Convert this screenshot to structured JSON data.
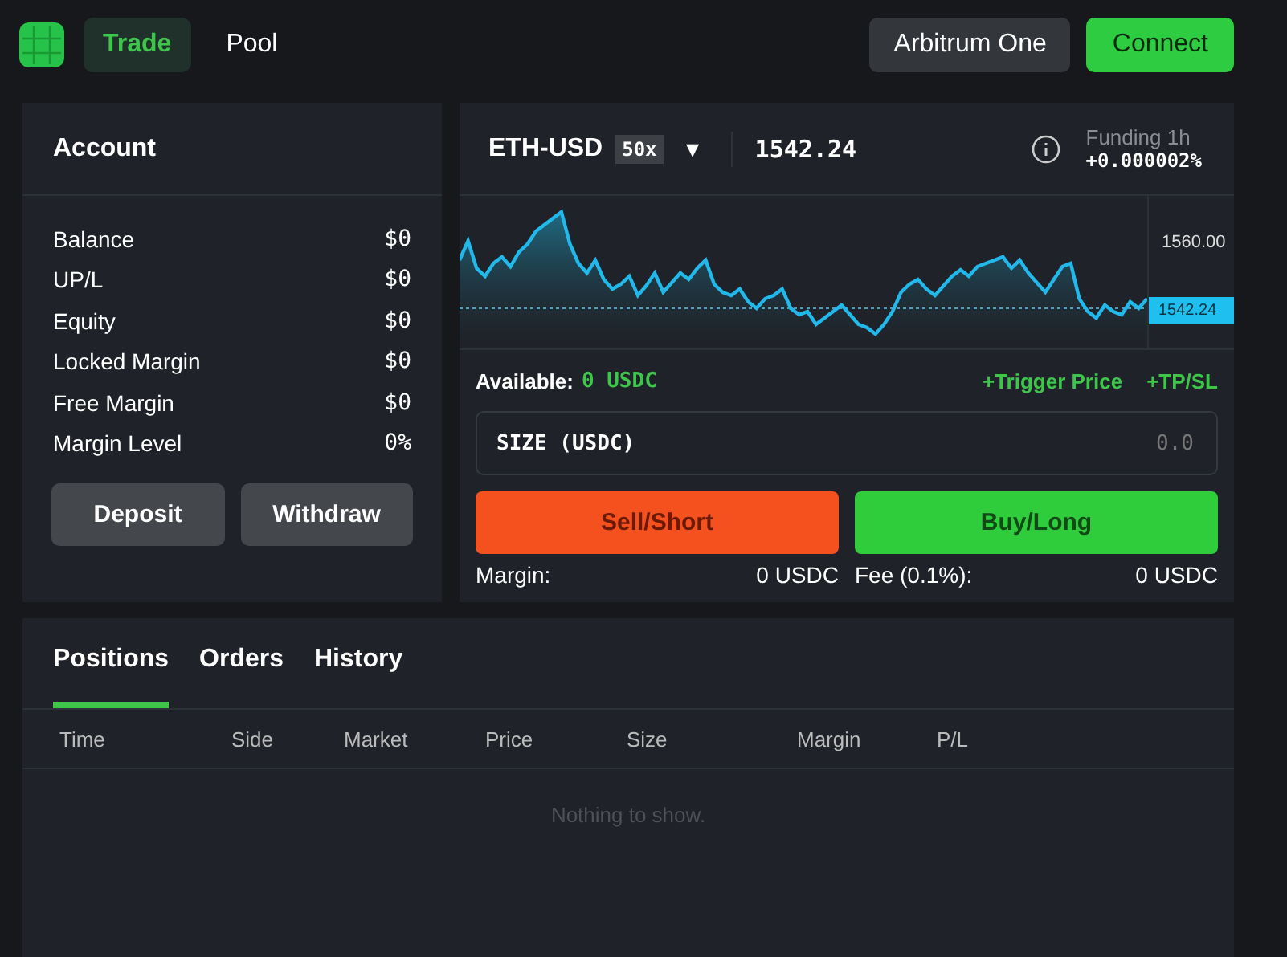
{
  "nav": [
    {
      "label": "Trade",
      "selected": true
    },
    {
      "label": "Pool",
      "selected": false
    }
  ],
  "network": "Arbitrum One",
  "connect": "Connect",
  "account": {
    "title": "Account",
    "rows": [
      {
        "label": "Balance",
        "value": "$0"
      },
      {
        "label": "UP/L",
        "value": "$0"
      },
      {
        "label": "Equity",
        "value": "$0"
      },
      {
        "label": "Locked Margin",
        "value": "$0"
      },
      {
        "label": "Free Margin",
        "value": "$0"
      },
      {
        "label": "Margin Level",
        "value": "0%"
      }
    ],
    "buttons": [
      "Deposit",
      "Withdraw"
    ]
  },
  "market": {
    "pair": "ETH-USD",
    "leverage": "50x",
    "caret": "▾",
    "price": "1542.24",
    "funding_label": "Funding 1h",
    "funding_value": "+0.000002%",
    "chart": {
      "axis_label": "1560.00",
      "price_tag": "1542.24"
    },
    "available_label": "Available:",
    "available_value": "0 USDC",
    "links": [
      "+Trigger Price",
      "+TP/SL"
    ],
    "size_field": {
      "label": "SIZE (USDC)",
      "placeholder": "0.0"
    },
    "sell": "Sell/Short",
    "buy": "Buy/Long",
    "margin_label": "Margin:",
    "margin_value": "0 USDC",
    "fee_label": "Fee (0.1%):",
    "fee_value": "0 USDC"
  },
  "tabs": [
    {
      "label": "Positions",
      "selected": true
    },
    {
      "label": "Orders",
      "selected": false
    },
    {
      "label": "History",
      "selected": false
    }
  ],
  "table": {
    "columns": [
      "Time",
      "Side",
      "Market",
      "Price",
      "Size",
      "Margin",
      "P/L"
    ],
    "empty": "Nothing to show."
  }
}
